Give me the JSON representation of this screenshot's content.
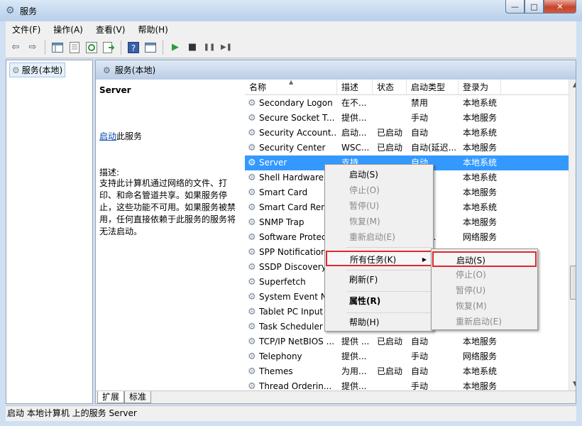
{
  "window": {
    "title": "服务",
    "close_glyph": "✕",
    "max_glyph": "□",
    "min_glyph": "—"
  },
  "menubar": [
    "文件(F)",
    "操作(A)",
    "查看(V)",
    "帮助(H)"
  ],
  "left_tree": {
    "item": "服务(本地)"
  },
  "right_header": "服务(本地)",
  "desc": {
    "title": "Server",
    "start_link": "启动",
    "start_suffix": "此服务",
    "label": "描述:",
    "body": "支持此计算机通过网络的文件、打印、和命名管道共享。如果服务停止，这些功能不可用。如果服务被禁用，任何直接依赖于此服务的服务将无法启动。"
  },
  "columns": [
    "名称",
    "描述",
    "状态",
    "启动类型",
    "登录为"
  ],
  "rows": [
    {
      "name": "Secondary Logon",
      "desc": "在不...",
      "status": "",
      "startup": "禁用",
      "logon": "本地系统"
    },
    {
      "name": "Secure Socket T...",
      "desc": "提供...",
      "status": "",
      "startup": "手动",
      "logon": "本地服务"
    },
    {
      "name": "Security Account...",
      "desc": "启动...",
      "status": "已启动",
      "startup": "自动",
      "logon": "本地系统"
    },
    {
      "name": "Security Center",
      "desc": "WSC...",
      "status": "已启动",
      "startup": "自动(延迟...",
      "logon": "本地服务"
    },
    {
      "name": "Server",
      "desc": "支持...",
      "status": "",
      "startup": "自动",
      "logon": "本地系统",
      "selected": true
    },
    {
      "name": "Shell Hardware",
      "desc": "",
      "status": "",
      "startup": "",
      "logon": "本地系统"
    },
    {
      "name": "Smart Card",
      "desc": "",
      "status": "",
      "startup": "",
      "logon": "本地服务"
    },
    {
      "name": "Smart Card Ren",
      "desc": "",
      "status": "",
      "startup": "",
      "logon": "本地系统"
    },
    {
      "name": "SNMP Trap",
      "desc": "",
      "status": "",
      "startup": "",
      "logon": "本地服务"
    },
    {
      "name": "Software Protec",
      "desc": "",
      "status": "",
      "startup": "延迟...",
      "logon": "网络服务"
    },
    {
      "name": "SPP Notification",
      "desc": "",
      "status": "",
      "startup": "",
      "logon": ""
    },
    {
      "name": "SSDP Discovery",
      "desc": "",
      "status": "",
      "startup": "",
      "logon": ""
    },
    {
      "name": "Superfetch",
      "desc": "",
      "status": "",
      "startup": "",
      "logon": ""
    },
    {
      "name": "System Event N",
      "desc": "",
      "status": "",
      "startup": "",
      "logon": ""
    },
    {
      "name": "Tablet PC Input",
      "desc": "",
      "status": "",
      "startup": "",
      "logon": ""
    },
    {
      "name": "Task Scheduler",
      "desc": "",
      "status": "",
      "startup": "",
      "logon": ""
    },
    {
      "name": "TCP/IP NetBIOS ...",
      "desc": "提供 ...",
      "status": "已启动",
      "startup": "自动",
      "logon": "本地服务"
    },
    {
      "name": "Telephony",
      "desc": "提供...",
      "status": "",
      "startup": "手动",
      "logon": "网络服务"
    },
    {
      "name": "Themes",
      "desc": "为用...",
      "status": "已启动",
      "startup": "自动",
      "logon": "本地系统"
    },
    {
      "name": "Thread Orderin...",
      "desc": "提供...",
      "status": "",
      "startup": "手动",
      "logon": "本地服务"
    }
  ],
  "tabs": [
    "扩展",
    "标准"
  ],
  "statusbar": "启动 本地计算机 上的服务 Server",
  "context_menu": {
    "start": "启动(S)",
    "stop": "停止(O)",
    "pause": "暂停(U)",
    "resume": "恢复(M)",
    "restart": "重新启动(E)",
    "all_tasks": "所有任务(K)",
    "refresh": "刷新(F)",
    "properties": "属性(R)",
    "help": "帮助(H)",
    "arrow": "▶"
  },
  "submenu": {
    "start": "启动(S)",
    "stop": "停止(O)",
    "pause": "暂停(U)",
    "resume": "恢复(M)",
    "restart": "重新启动(E)"
  },
  "icons": {
    "gear": "⚙",
    "back": "⇦",
    "forward": "⇨",
    "play": "▶",
    "stop": "■",
    "pause": "❚❚",
    "restart": "▶❚"
  },
  "colors": {
    "selection": "#3399ff",
    "highlight_box": "#e0282f",
    "link": "#0645ad"
  }
}
